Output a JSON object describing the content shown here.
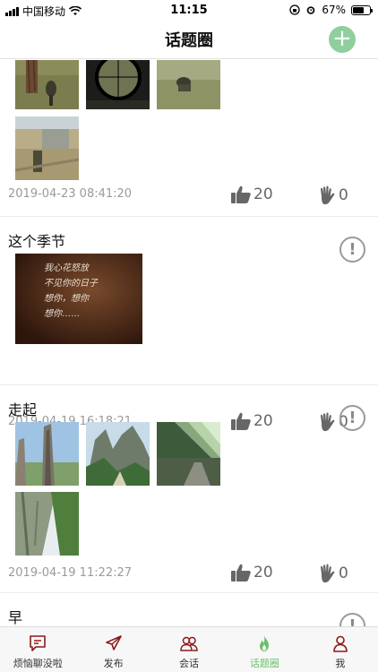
{
  "status_bar": {
    "carrier": "中国移动",
    "time": "11:15",
    "battery": "67%",
    "battery_level": 0.67
  },
  "header": {
    "title": "话题圈",
    "add_icon": "plus-circle-icon"
  },
  "posts": [
    {
      "title": "",
      "timestamp": "2019-04-23 08:41:20",
      "likes": "20",
      "waves": "0"
    },
    {
      "title": "这个季节",
      "image_text": "我心花怒放\n不见你的日子\n想你，想你\n想你……",
      "timestamp": "2019-04-19 16:18:21",
      "likes": "20",
      "waves": "0"
    },
    {
      "title": "走起",
      "timestamp": "2019-04-19 11:22:27",
      "likes": "20",
      "waves": "0"
    },
    {
      "title": "早"
    }
  ],
  "tabs": [
    {
      "label": "烦恼聊没啦",
      "icon": "chat-bubble-icon",
      "active": false
    },
    {
      "label": "发布",
      "icon": "paper-plane-icon",
      "active": false
    },
    {
      "label": "会话",
      "icon": "people-icon",
      "active": false
    },
    {
      "label": "话题圈",
      "icon": "flame-icon",
      "active": true
    },
    {
      "label": "我",
      "icon": "person-icon",
      "active": false
    }
  ],
  "colors": {
    "accent": "#6dbf6b",
    "add_button": "#8fcf9d",
    "meta_text": "#9a9a9a"
  }
}
